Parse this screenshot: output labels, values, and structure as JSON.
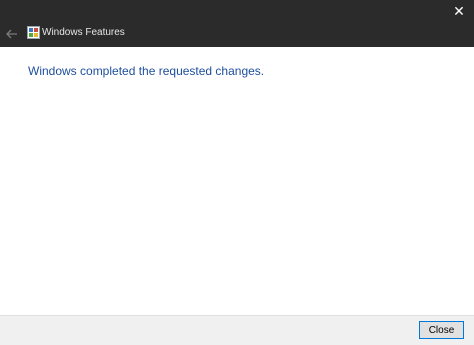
{
  "titlebar": {
    "close_icon": "close-icon",
    "close_glyph": "✕"
  },
  "nav": {
    "back_icon": "back-arrow-icon",
    "app_icon": "windows-features-icon",
    "title": "Windows Features"
  },
  "content": {
    "message": "Windows completed the requested changes."
  },
  "footer": {
    "close_label": "Close"
  },
  "colors": {
    "titlebar_bg": "#2b2b2b",
    "message_text": "#1e4e9c",
    "button_border": "#0078d7"
  }
}
